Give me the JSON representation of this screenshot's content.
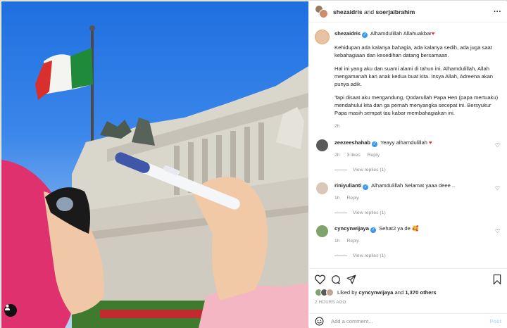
{
  "header": {
    "user1": "shezaidris",
    "joiner": "and",
    "user2": "soerjaibrahim"
  },
  "caption": {
    "username": "shezaidris",
    "first_line": "Alhamdulillah Allahuakbar",
    "heart": "♥",
    "paragraphs": [
      "Kehidupan ada kalanya bahagia, ada kalanya sedih, ada juga saat kebahagiaan dan kesedihan datang bersamaan.",
      "Hal ini yang aku dan suami alami di tahun ini. Alhamdulillah, Allah mengamanah kan anak kedua buat kita. Insya Allah, Adreena akan punya adik.",
      "Tapi disaat aku mengandung, Qodarullah Papa Hen (papa mertuaku) mendahului kita dan ga pernah menyangka secepat ini. Bersyukur Papa masih sempat tau kabar membahagiakan ini."
    ],
    "time": "2h"
  },
  "comments": [
    {
      "username": "zeezeeshahab",
      "text": "Yeayy alhamdulillah",
      "emoji": "♥",
      "time": "2h",
      "likes": "3 likes",
      "reply": "Reply",
      "view_replies": "View replies (1)",
      "avatar_color": "#5a5a5a"
    },
    {
      "username": "riniyulianti",
      "text": "Alhamdulillah Selamat yaaa deee ..",
      "emoji": "",
      "time": "1h",
      "likes": "",
      "reply": "Reply",
      "view_replies": "View replies (1)",
      "avatar_color": "#d9c7b8"
    },
    {
      "username": "cyncynwijaya",
      "text": "Sehat2 ya de",
      "emoji": "🥰",
      "time": "1h",
      "likes": "",
      "reply": "Reply",
      "view_replies": "View replies (1)",
      "avatar_color": "#7fa36b"
    }
  ],
  "likes": {
    "prefix": "Liked by",
    "user": "cyncynwijaya",
    "and": "and",
    "count": "1,370 others"
  },
  "posted_ago": "2 HOURS AGO",
  "add_comment": {
    "placeholder": "Add a comment...",
    "post_label": "Post"
  },
  "colors": {
    "verified": "#3897f0",
    "heart": "#ed2a3c",
    "post_disabled": "#b2dffc",
    "muted": "#8e8e8e"
  },
  "icons": [
    "more-icon",
    "heart-icon",
    "comment-icon",
    "share-icon",
    "bookmark-icon",
    "smile-icon",
    "user-tag-icon",
    "verified-icon"
  ]
}
